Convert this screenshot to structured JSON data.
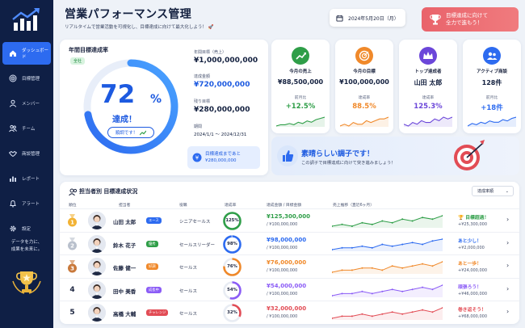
{
  "sidebar": {
    "items": [
      {
        "label": "ダッシュボード",
        "icon": "home-icon",
        "active": true
      },
      {
        "label": "目標管理",
        "icon": "target-icon"
      },
      {
        "label": "メンバー",
        "icon": "user-icon"
      },
      {
        "label": "チーム",
        "icon": "team-icon"
      },
      {
        "label": "商談管理",
        "icon": "handshake-icon"
      },
      {
        "label": "レポート",
        "icon": "bar-chart-icon"
      },
      {
        "label": "アラート",
        "icon": "bell-icon"
      },
      {
        "label": "設定",
        "icon": "gear-icon"
      }
    ],
    "footer_line1": "データを力に、",
    "footer_line2": "成果を未来に。"
  },
  "header": {
    "title": "営業パフォーマンス管理",
    "subtitle": "リアルタイムで営業活動を可視化し、目標達成に向けて最大化しよう！",
    "date": "2024年5月20日（月）",
    "goal_button_line1": "目標達成に向けて",
    "goal_button_line2": "全力で進もう！"
  },
  "annual": {
    "title": "年間目標達成率",
    "badge": "全社",
    "percent": "72",
    "percent_value": 0.72,
    "percent_sign": "%",
    "achieved": "達成！",
    "status_pill": "順調です！",
    "target_label": "年間目標（売上）",
    "target_value": "¥1,000,000,000",
    "achieved_label": "達成金額",
    "achieved_value": "¥720,000,000",
    "remaining_label": "残り目標",
    "remaining_value": "¥280,000,000",
    "period_label": "期間",
    "period_value": "2024/1/1 〜 2024/12/31",
    "remain_note_line1": "目標達成まであと",
    "remain_note_line2": "¥280,000,000"
  },
  "kpis": [
    {
      "label": "今月の売上",
      "value": "¥88,500,000",
      "sub": "前月比",
      "change": "+12.5%",
      "color": "#2f9e48",
      "bg": "#2f9e48",
      "icon": "trend-up-icon",
      "spark": [
        3,
        4,
        4,
        5,
        4,
        6,
        5,
        7,
        6,
        8,
        9,
        10
      ]
    },
    {
      "label": "今月の目標",
      "value": "¥100,000,000",
      "sub": "達成率",
      "change": "88.5%",
      "color": "#f0892a",
      "bg": "#f0892a",
      "icon": "target-icon",
      "spark": [
        4,
        5,
        4,
        6,
        5,
        5,
        7,
        6,
        7,
        8,
        8,
        9
      ]
    },
    {
      "label": "トップ達成者",
      "value": "山田 太郎",
      "sub": "達成率",
      "change": "125.3%",
      "color": "#6b46d9",
      "bg": "#6b46d9",
      "icon": "crown-icon",
      "spark": [
        5,
        4,
        6,
        5,
        7,
        6,
        6,
        8,
        7,
        9,
        8,
        9
      ]
    },
    {
      "label": "アクティブ商談",
      "value": "128件",
      "sub": "前月比",
      "change": "+18件",
      "color": "#2d6bf0",
      "bg": "#2d6bf0",
      "icon": "users-icon",
      "spark": [
        3,
        5,
        4,
        6,
        5,
        7,
        6,
        6,
        8,
        7,
        9,
        10
      ]
    }
  ],
  "banner": {
    "headline": "素晴らしい調子です！",
    "message": "この調子で目標達成に向けて突き進みましょう！"
  },
  "table": {
    "title": "担当者別 目標達成状況",
    "sort_label": "達成率順",
    "headers": [
      "順位",
      "担当者",
      "役職",
      "達成率",
      "達成金額 / 目標金額",
      "売上推移（直近6ヶ月）"
    ],
    "rows": [
      {
        "rank": "1",
        "medal": "#f2b233",
        "name": "山田 太郎",
        "tag": "エース",
        "tag_color": "#2d6bf0",
        "role": "シニアセールス",
        "rate": "125%",
        "rate_value": 1.0,
        "ring_color": "#2f9e48",
        "amount": "¥125,300,000",
        "amount_color": "#2f9e48",
        "target": "/ ¥100,000,000",
        "status": "目標超過！",
        "status_color": "#2f9e48",
        "status_icon": "trophy-icon",
        "status_sub": "+¥25,300,000",
        "trend": [
          6,
          7,
          6,
          8,
          7,
          9,
          8,
          10,
          9,
          11,
          10,
          12
        ]
      },
      {
        "rank": "2",
        "medal": "#b9c0cc",
        "name": "鈴木 花子",
        "tag": "優秀",
        "tag_color": "#2f9e48",
        "role": "セールスリーダー",
        "rate": "98%",
        "rate_value": 0.98,
        "ring_color": "#2d6bf0",
        "amount": "¥98,000,000",
        "amount_color": "#2d6bf0",
        "target": "/ ¥100,000,000",
        "status": "あと少し！",
        "status_color": "#2d6bf0",
        "status_icon": "",
        "status_sub": "+¥2,000,000",
        "trend": [
          5,
          6,
          6,
          7,
          6,
          8,
          7,
          8,
          9,
          8,
          10,
          11
        ]
      },
      {
        "rank": "3",
        "medal": "#c9793b",
        "name": "佐藤 健一",
        "tag": "好調",
        "tag_color": "#f0892a",
        "role": "セールス",
        "rate": "76%",
        "rate_value": 0.76,
        "ring_color": "#f0892a",
        "amount": "¥76,000,000",
        "amount_color": "#f0892a",
        "target": "/ ¥100,000,000",
        "status": "あと一歩！",
        "status_color": "#f0892a",
        "status_icon": "",
        "status_sub": "+¥24,000,000",
        "trend": [
          4,
          5,
          5,
          6,
          6,
          5,
          7,
          6,
          7,
          8,
          7,
          9
        ]
      },
      {
        "rank": "4",
        "medal": "",
        "name": "田中 美香",
        "tag": "成長中",
        "tag_color": "#8b5cf6",
        "role": "セールス",
        "rate": "54%",
        "rate_value": 0.54,
        "ring_color": "#8b5cf6",
        "amount": "¥54,000,000",
        "amount_color": "#8b5cf6",
        "target": "/ ¥100,000,000",
        "status": "頑張ろう！",
        "status_color": "#8b5cf6",
        "status_icon": "",
        "status_sub": "+¥46,000,000",
        "trend": [
          3,
          4,
          4,
          5,
          4,
          5,
          6,
          5,
          6,
          7,
          6,
          8
        ]
      },
      {
        "rank": "5",
        "medal": "",
        "name": "高橋 大輔",
        "tag": "チャレンジ",
        "tag_color": "#e24c55",
        "role": "セールス",
        "rate": "32%",
        "rate_value": 0.32,
        "ring_color": "#e24c55",
        "amount": "¥32,000,000",
        "amount_color": "#e24c55",
        "target": "/ ¥100,000,000",
        "status": "巻き返そう！",
        "status_color": "#e24c55",
        "status_icon": "",
        "status_sub": "+¥68,000,000",
        "trend": [
          2,
          3,
          3,
          4,
          3,
          4,
          5,
          4,
          5,
          6,
          5,
          7
        ]
      }
    ]
  }
}
